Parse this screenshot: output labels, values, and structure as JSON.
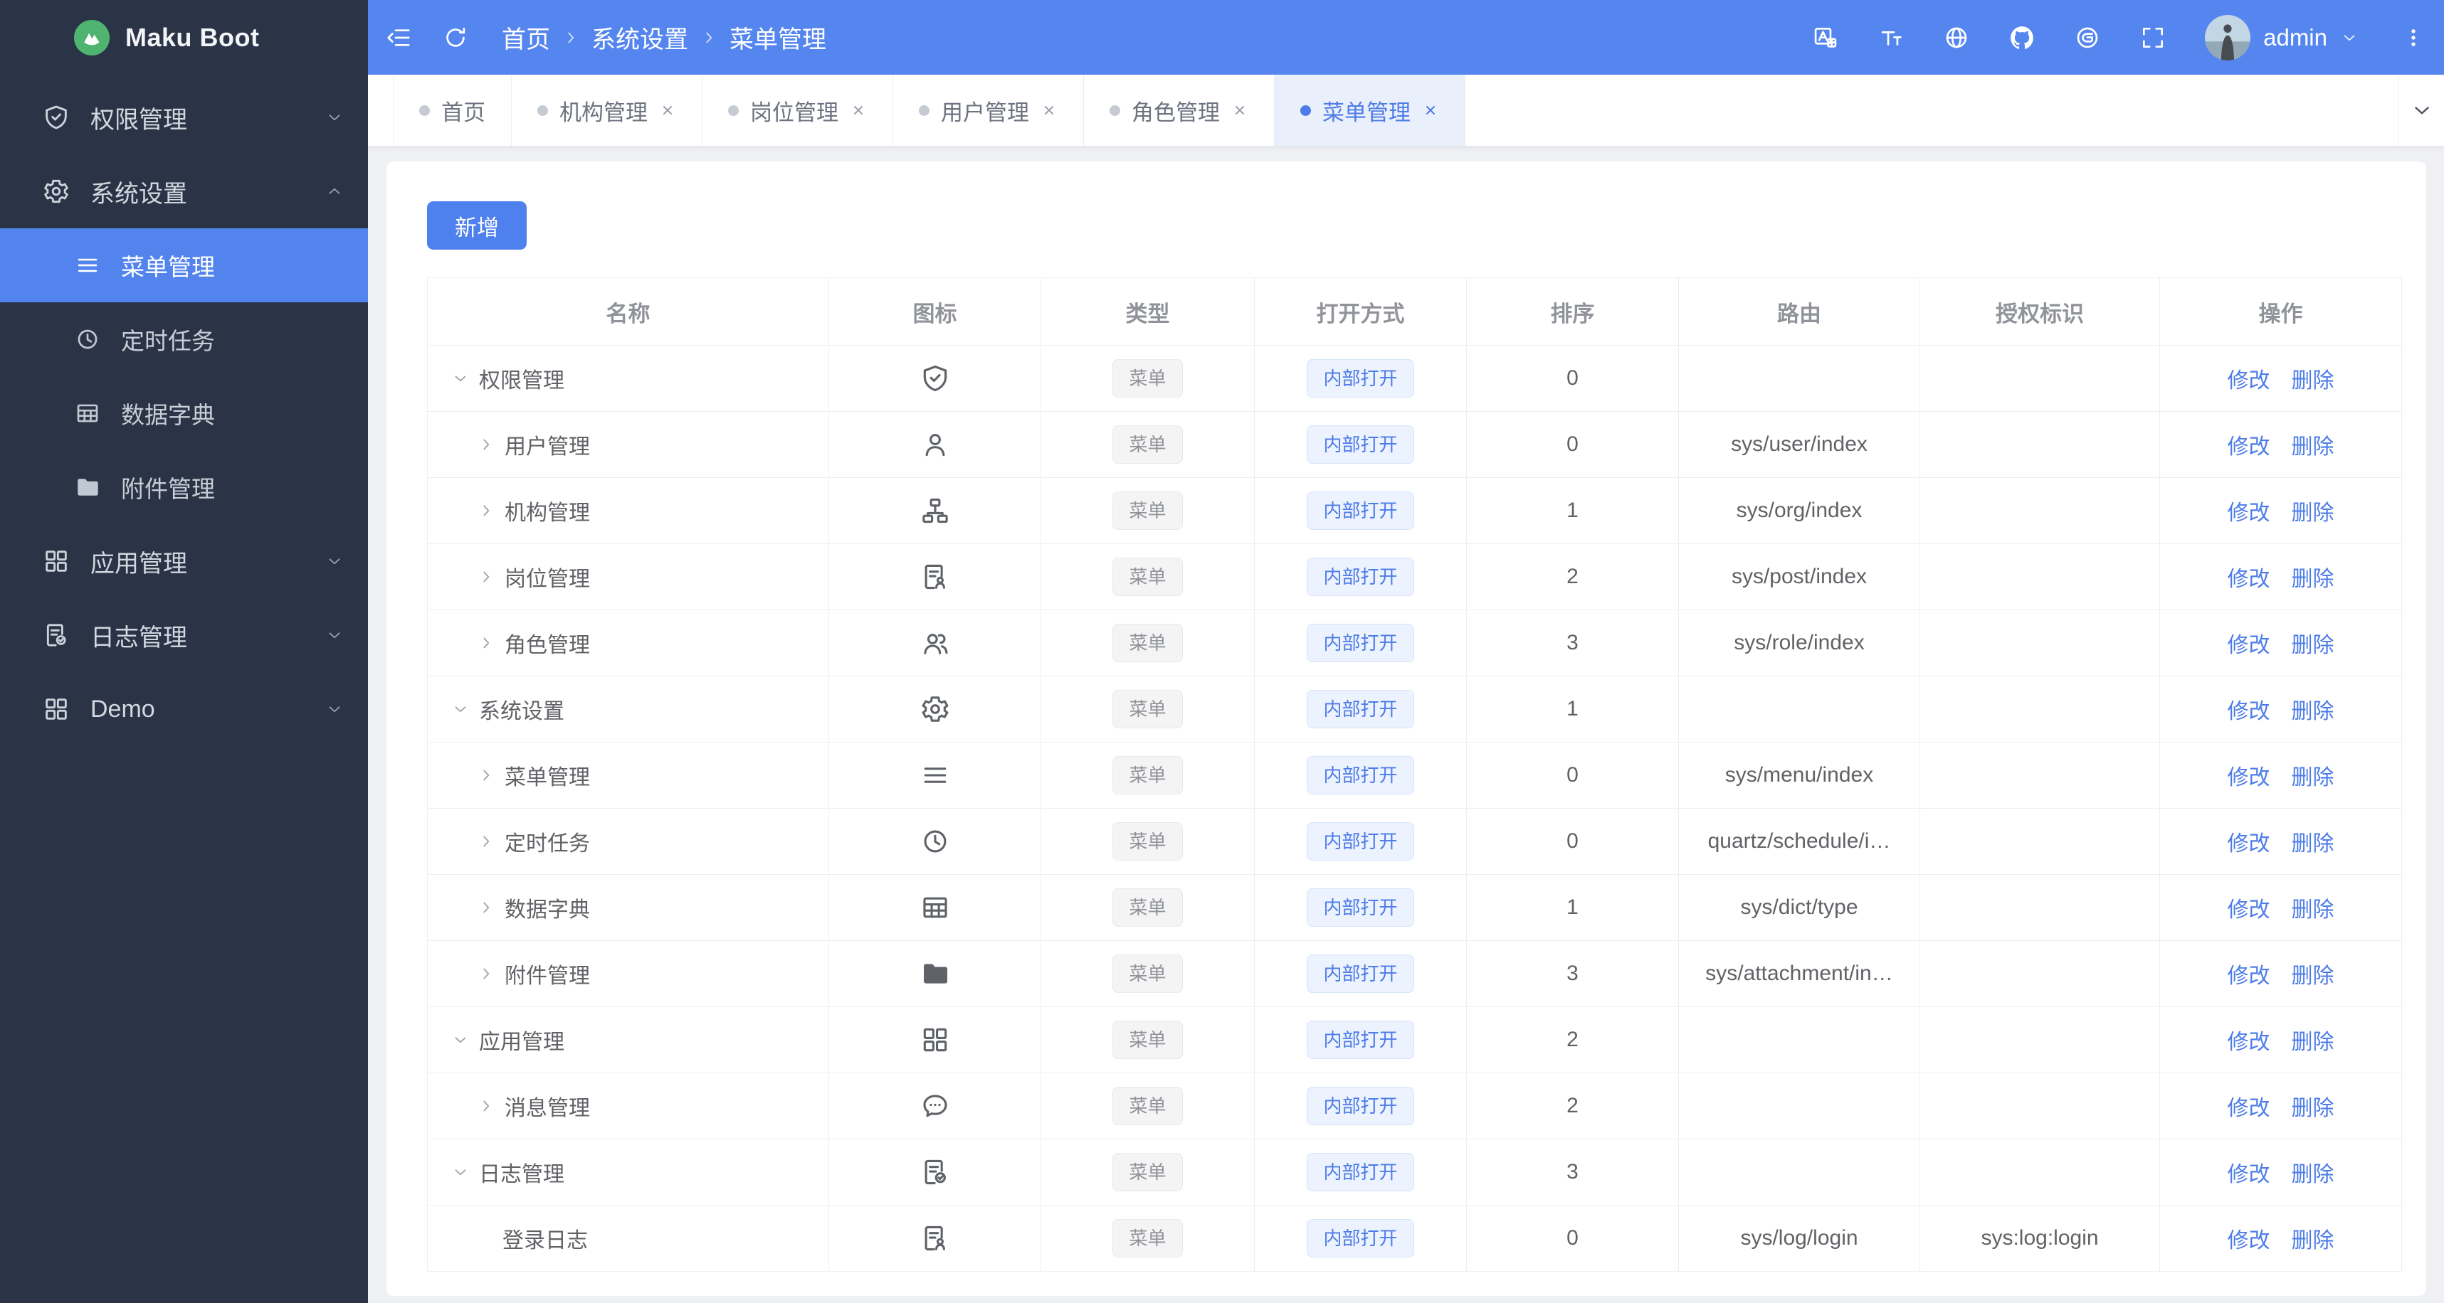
{
  "app": {
    "name": "Maku Boot"
  },
  "colors": {
    "primary": "#4d7ce8",
    "header_bg": "#5585ee",
    "sidebar_bg": "#2a3446",
    "sidebar_active": "#5384ee",
    "logo_green": "#4fb46f",
    "tag_info_bg": "#f4f4f5",
    "tag_info_text": "#909399",
    "tag_primary_bg": "#ecf2fe",
    "tag_primary_text": "#4d7ce8",
    "tab_active_bg": "#e9effb",
    "table_border": "#ebeef5",
    "page_bg": "#eef0f4"
  },
  "header": {
    "breadcrumb": [
      "首页",
      "系统设置",
      "菜单管理"
    ],
    "user": "admin",
    "left_icons": [
      {
        "key": "fold",
        "name": "menu-fold-icon"
      },
      {
        "key": "refresh",
        "name": "refresh-icon"
      }
    ],
    "right_icons": [
      {
        "key": "translate",
        "name": "translate-icon"
      },
      {
        "key": "fontsize",
        "name": "font-size-icon"
      },
      {
        "key": "globe",
        "name": "globe-icon"
      },
      {
        "key": "github",
        "name": "github-icon"
      },
      {
        "key": "gitee",
        "name": "gitee-icon"
      },
      {
        "key": "full",
        "name": "fullscreen-icon"
      }
    ]
  },
  "sidebar": {
    "items": [
      {
        "key": "permission-management",
        "label": "权限管理",
        "icon": "shield-check",
        "kind": "top",
        "chevron": "down"
      },
      {
        "key": "system-settings",
        "label": "系统设置",
        "icon": "gear",
        "kind": "top",
        "chevron": "up"
      },
      {
        "key": "menu-management",
        "label": "菜单管理",
        "icon": "menu",
        "kind": "sub",
        "active": true
      },
      {
        "key": "scheduled-tasks",
        "label": "定时任务",
        "icon": "clock",
        "kind": "sub"
      },
      {
        "key": "data-dictionary",
        "label": "数据字典",
        "icon": "grid-table",
        "kind": "sub"
      },
      {
        "key": "attachment-management",
        "label": "附件管理",
        "icon": "folder",
        "kind": "sub"
      },
      {
        "key": "app-management",
        "label": "应用管理",
        "icon": "grid",
        "kind": "top",
        "chevron": "down"
      },
      {
        "key": "log-management",
        "label": "日志管理",
        "icon": "doc-check",
        "kind": "top",
        "chevron": "down"
      },
      {
        "key": "demo",
        "label": "Demo",
        "icon": "grid",
        "kind": "top",
        "chevron": "down"
      }
    ]
  },
  "tabs": {
    "items": [
      {
        "key": "home",
        "label": "首页",
        "closable": false,
        "active": false
      },
      {
        "key": "org-management",
        "label": "机构管理",
        "closable": true,
        "active": false
      },
      {
        "key": "post-management",
        "label": "岗位管理",
        "closable": true,
        "active": false
      },
      {
        "key": "user-management",
        "label": "用户管理",
        "closable": true,
        "active": false
      },
      {
        "key": "role-management",
        "label": "角色管理",
        "closable": true,
        "active": false
      },
      {
        "key": "menu-management",
        "label": "菜单管理",
        "closable": true,
        "active": true
      }
    ]
  },
  "toolbar": {
    "add_label": "新增"
  },
  "table": {
    "columns": [
      "名称",
      "图标",
      "类型",
      "打开方式",
      "排序",
      "路由",
      "授权标识",
      "操作"
    ],
    "tag_menu": "菜单",
    "tag_open": "内部打开",
    "action_edit": "修改",
    "action_delete": "删除",
    "rows": [
      {
        "key": "permission",
        "name": "权限管理",
        "level": 0,
        "expand": "down",
        "icon": "shield-check",
        "sort": "0",
        "route": "",
        "perm": ""
      },
      {
        "key": "user",
        "name": "用户管理",
        "level": 1,
        "expand": "right",
        "icon": "user",
        "sort": "0",
        "route": "sys/user/index",
        "perm": ""
      },
      {
        "key": "org",
        "name": "机构管理",
        "level": 1,
        "expand": "right",
        "icon": "org",
        "sort": "1",
        "route": "sys/org/index",
        "perm": ""
      },
      {
        "key": "post",
        "name": "岗位管理",
        "level": 1,
        "expand": "right",
        "icon": "doc-person",
        "sort": "2",
        "route": "sys/post/index",
        "perm": ""
      },
      {
        "key": "role",
        "name": "角色管理",
        "level": 1,
        "expand": "right",
        "icon": "users",
        "sort": "3",
        "route": "sys/role/index",
        "perm": ""
      },
      {
        "key": "system",
        "name": "系统设置",
        "level": 0,
        "expand": "down",
        "icon": "gear",
        "sort": "1",
        "route": "",
        "perm": ""
      },
      {
        "key": "menu",
        "name": "菜单管理",
        "level": 1,
        "expand": "right",
        "icon": "menu",
        "sort": "0",
        "route": "sys/menu/index",
        "perm": ""
      },
      {
        "key": "schedule",
        "name": "定时任务",
        "level": 1,
        "expand": "right",
        "icon": "clock",
        "sort": "0",
        "route": "quartz/schedule/i…",
        "perm": ""
      },
      {
        "key": "dict",
        "name": "数据字典",
        "level": 1,
        "expand": "right",
        "icon": "grid-table",
        "sort": "1",
        "route": "sys/dict/type",
        "perm": ""
      },
      {
        "key": "attachment",
        "name": "附件管理",
        "level": 1,
        "expand": "right",
        "icon": "folder",
        "sort": "3",
        "route": "sys/attachment/in…",
        "perm": ""
      },
      {
        "key": "app",
        "name": "应用管理",
        "level": 0,
        "expand": "down",
        "icon": "grid",
        "sort": "2",
        "route": "",
        "perm": ""
      },
      {
        "key": "message",
        "name": "消息管理",
        "level": 1,
        "expand": "right",
        "icon": "chat",
        "sort": "2",
        "route": "",
        "perm": ""
      },
      {
        "key": "log",
        "name": "日志管理",
        "level": 0,
        "expand": "down",
        "icon": "doc-check",
        "sort": "3",
        "route": "",
        "perm": ""
      },
      {
        "key": "login-log",
        "name": "登录日志",
        "level": 2,
        "expand": null,
        "icon": "doc-person",
        "sort": "0",
        "route": "sys/log/login",
        "perm": "sys:log:login"
      }
    ]
  }
}
